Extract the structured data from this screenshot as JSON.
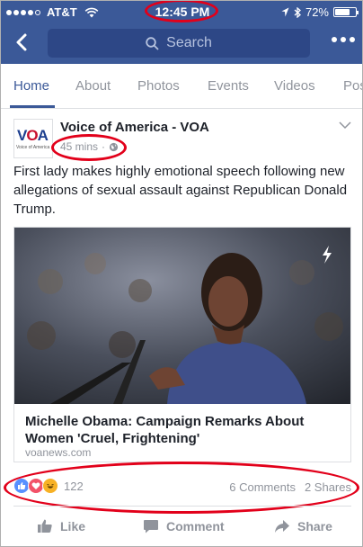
{
  "status_bar": {
    "carrier": "AT&T",
    "time": "12:45 PM",
    "battery": "72%",
    "battery_level": 0.72,
    "signal_bars": 4
  },
  "nav": {
    "search_placeholder": "Search"
  },
  "tabs": [
    {
      "label": "Home",
      "active": true
    },
    {
      "label": "About",
      "active": false
    },
    {
      "label": "Photos",
      "active": false
    },
    {
      "label": "Events",
      "active": false
    },
    {
      "label": "Videos",
      "active": false
    },
    {
      "label": "Pos",
      "active": false
    }
  ],
  "post": {
    "page_name": "Voice of America - VOA",
    "avatar_logo": "VOA",
    "avatar_subtitle": "Voice of America",
    "time": "45 mins",
    "text": "First lady makes highly emotional speech following new allegations of sexual assault against Republican Donald Trump.",
    "link": {
      "title": "Michelle Obama: Campaign Remarks About Women 'Cruel, Frightening'",
      "domain": "voanews.com",
      "badge_icon": "instant-article-bolt-icon"
    },
    "reactions": {
      "types": [
        "like",
        "love",
        "haha"
      ],
      "count": "122",
      "comments": "6 Comments",
      "shares": "2 Shares"
    },
    "actions": {
      "like": "Like",
      "comment": "Comment",
      "share": "Share"
    }
  },
  "colors": {
    "brand": "#3b5998",
    "annotation_ring": "#e2001a"
  }
}
